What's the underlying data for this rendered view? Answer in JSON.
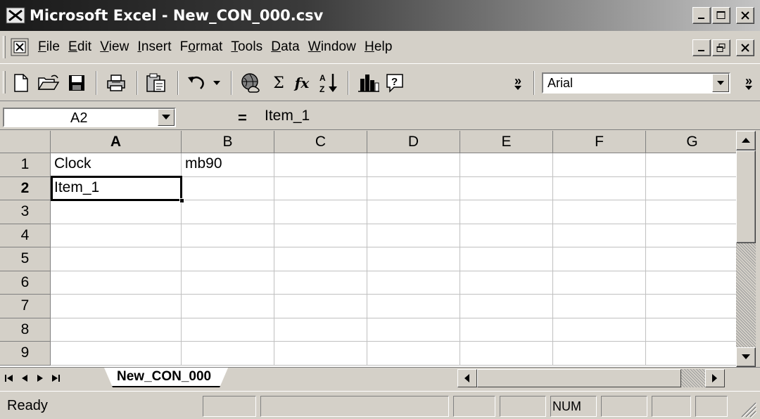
{
  "window": {
    "title": "Microsoft Excel - New_CON_000.csv"
  },
  "menu": {
    "items": [
      {
        "underline": "F",
        "rest": "ile"
      },
      {
        "underline": "E",
        "rest": "dit"
      },
      {
        "underline": "V",
        "rest": "iew"
      },
      {
        "underline": "I",
        "rest": "nsert"
      },
      {
        "pre": "F",
        "underline": "o",
        "rest": "rmat"
      },
      {
        "underline": "T",
        "rest": "ools"
      },
      {
        "underline": "D",
        "rest": "ata"
      },
      {
        "underline": "W",
        "rest": "indow"
      },
      {
        "underline": "H",
        "rest": "elp"
      }
    ]
  },
  "toolbar": {
    "font_name": "Arial",
    "sigma_symbol": "Σ",
    "fx_symbol": "fx",
    "chevron": "»"
  },
  "formula_bar": {
    "name_box": "A2",
    "equals": "=",
    "content": "Item_1"
  },
  "sheet": {
    "columns": [
      "A",
      "B",
      "C",
      "D",
      "E",
      "F",
      "G"
    ],
    "rows": [
      "1",
      "2",
      "3",
      "4",
      "5",
      "6",
      "7",
      "8",
      "9"
    ],
    "active_column": "A",
    "active_row": "2",
    "cells": [
      [
        "Clock",
        "mb90",
        "",
        "",
        "",
        "",
        ""
      ],
      [
        "Item_1",
        "",
        "",
        "",
        "",
        "",
        ""
      ],
      [
        "",
        "",
        "",
        "",
        "",
        "",
        ""
      ],
      [
        "",
        "",
        "",
        "",
        "",
        "",
        ""
      ],
      [
        "",
        "",
        "",
        "",
        "",
        "",
        ""
      ],
      [
        "",
        "",
        "",
        "",
        "",
        "",
        ""
      ],
      [
        "",
        "",
        "",
        "",
        "",
        "",
        ""
      ],
      [
        "",
        "",
        "",
        "",
        "",
        "",
        ""
      ],
      [
        "",
        "",
        "",
        "",
        "",
        "",
        ""
      ]
    ]
  },
  "tabs": {
    "active_tab": "New_CON_000"
  },
  "status": {
    "mode": "Ready",
    "num_indicator": "NUM"
  }
}
